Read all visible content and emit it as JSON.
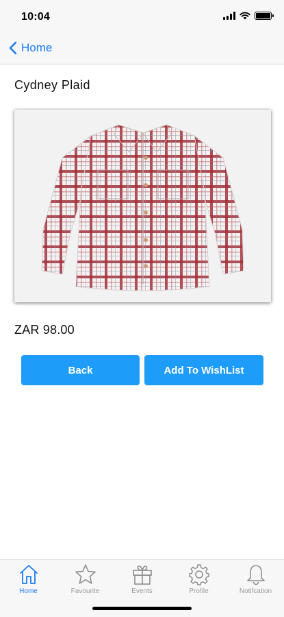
{
  "status_bar": {
    "time": "10:04"
  },
  "nav": {
    "back_label": "Home"
  },
  "product": {
    "name": "Cydney Plaid",
    "price": "ZAR 98.00",
    "image_icon": "plaid-shirt-image"
  },
  "actions": {
    "back_label": "Back",
    "wishlist_label": "Add To WishList"
  },
  "tabs": [
    {
      "label": "Home",
      "icon": "home-icon",
      "active": true
    },
    {
      "label": "Favourite",
      "icon": "star-icon",
      "active": false
    },
    {
      "label": "Events",
      "icon": "gift-icon",
      "active": false
    },
    {
      "label": "Profile",
      "icon": "gear-icon",
      "active": false
    },
    {
      "label": "Notifcation",
      "icon": "bell-icon",
      "active": false
    }
  ],
  "colors": {
    "accent": "#1a7cf5",
    "button": "#1e9cf9",
    "tab_inactive": "#9b9b9b"
  }
}
